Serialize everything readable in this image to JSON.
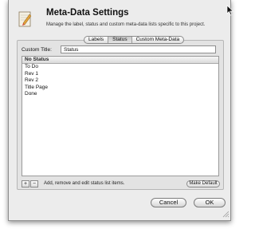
{
  "dialog": {
    "title": "Meta-Data Settings",
    "subtitle": "Manage the label, status and custom meta-data lists specific to this project."
  },
  "tabs": [
    {
      "label": "Labels",
      "active": false
    },
    {
      "label": "Status",
      "active": true
    },
    {
      "label": "Custom Meta-Data",
      "active": false
    }
  ],
  "custom_title": {
    "label": "Custom Title:",
    "value": "Status"
  },
  "status_list": {
    "items": [
      "No Status",
      "To Do",
      "Rev 1",
      "Rev 2",
      "Title Page",
      "Done"
    ]
  },
  "list_controls": {
    "add_label": "+",
    "remove_label": "−",
    "hint": "Add, remove and edit status list items.",
    "make_default_label": "Make Default"
  },
  "footer": {
    "cancel_label": "Cancel",
    "ok_label": "OK"
  },
  "icons": {
    "app": "notebook-pencil-icon",
    "grip": "resize-grip-icon",
    "cursor": "mouse-pointer-icon"
  }
}
